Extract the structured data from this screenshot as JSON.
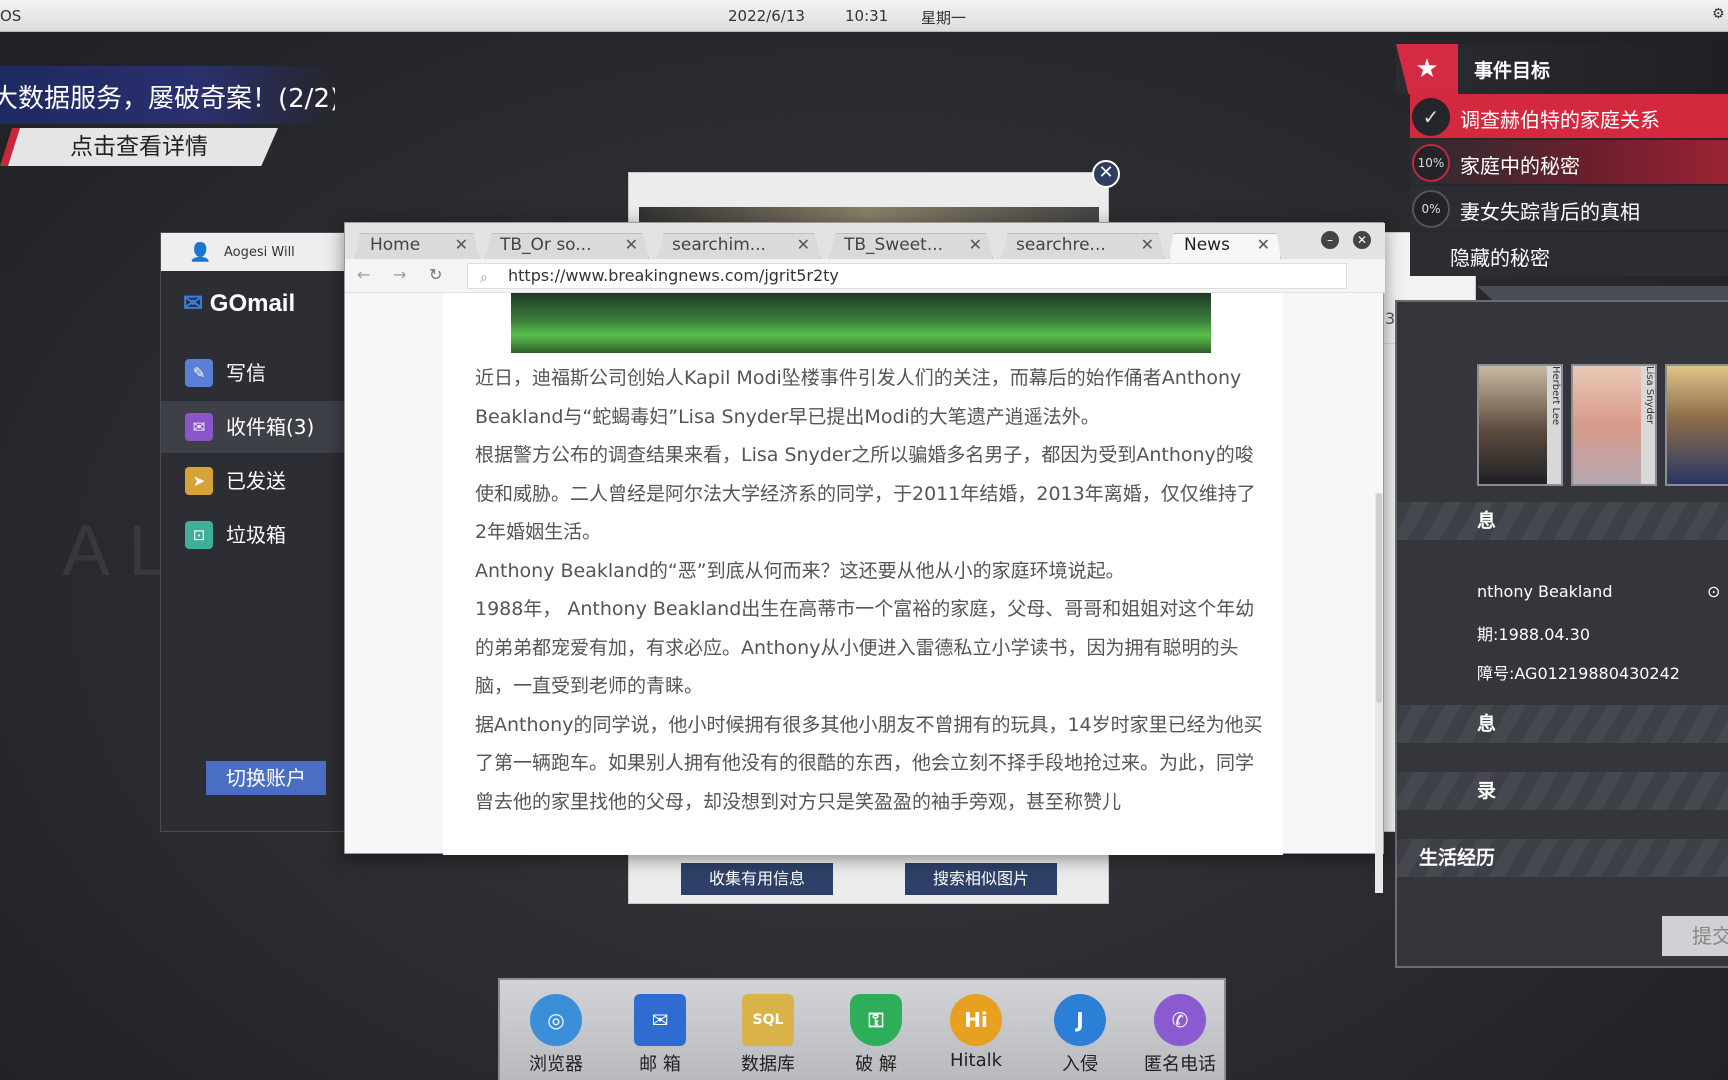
{
  "topbar": {
    "os": "OS",
    "date": "2022/6/13",
    "time": "10:31",
    "weekday": "星期一"
  },
  "banner": {
    "title": "大数据服务，屡破奇案！(2/2)",
    "details": "点击查看详情"
  },
  "background_text": "AL",
  "mail": {
    "user": "Aogesi Will",
    "logo": "GOmail",
    "items": [
      {
        "label": "写信",
        "icon": "compose-icon",
        "color": "#5a7fd6"
      },
      {
        "label": "收件箱(3)",
        "icon": "inbox-icon",
        "color": "#8a55c8"
      },
      {
        "label": "已发送",
        "icon": "send-icon",
        "color": "#d8a23a"
      },
      {
        "label": "垃圾箱",
        "icon": "trash-icon",
        "color": "#3fae9a"
      }
    ],
    "switch_account": "切换账户"
  },
  "image_window": {
    "collect": "收集有用信息",
    "search_similar": "搜索相似图片"
  },
  "browser": {
    "tabs": [
      {
        "label": "Home"
      },
      {
        "label": "TB_Or so..."
      },
      {
        "label": "searchim..."
      },
      {
        "label": "TB_Sweet..."
      },
      {
        "label": "searchre..."
      },
      {
        "label": "News",
        "active": true
      }
    ],
    "url": "https://www.breakingnews.com/jgrit5r2ty",
    "paragraphs": [
      "近日，迪福斯公司创始人Kapil Modi坠楼事件引发人们的关注，而幕后的始作俑者Anthony Beakland与“蛇蝎毒妇”Lisa Snyder早已提出Modi的大笔遗产逍遥法外。",
      "根据警方公布的调查结果来看，Lisa Snyder之所以骗婚多名男子，都因为受到Anthony的唆使和威胁。二人曾经是阿尔法大学经济系的同学，于2011年结婚，2013年离婚，仅仅维持了2年婚姻生活。",
      "Anthony Beakland的“恶”到底从何而来？这还要从他从小的家庭环境说起。",
      "1988年， Anthony Beakland出生在高蒂市一个富裕的家庭，父母、哥哥和姐姐对这个年幼的弟弟都宠爱有加，有求必应。Anthony从小便进入雷德私立小学读书，因为拥有聪明的头脑，一直受到老师的青睐。",
      "据Anthony的同学说，他小时候拥有很多其他小朋友不曾拥有的玩具，14岁时家里已经为他买了第一辆跑车。如果别人拥有他没有的很酷的东西，他会立刻不择手段地抢过来。为此，同学曾去他的家里找他的父母，却没想到对方只是笑盈盈的袖手旁观，甚至称赞儿"
    ]
  },
  "profile_window": {
    "partial_number": "3"
  },
  "objectives": {
    "title": "事件目标",
    "items": [
      {
        "badge": "✓",
        "text": "调查赫伯特的家庭关系",
        "done": true
      },
      {
        "badge": "10%",
        "text": "家庭中的秘密"
      },
      {
        "badge": "0%",
        "text": "妻女失踪背后的真相"
      },
      {
        "badge": "",
        "text": "隐藏的秘密"
      }
    ]
  },
  "characters": {
    "portraits": [
      {
        "name": "Herbert Lee"
      },
      {
        "name": "Lisa Snyder"
      },
      {
        "name": ""
      }
    ],
    "section1": "息",
    "name_line": "nthony Beakland",
    "birth_line": "期:1988.04.30",
    "id_line": "障号:AG01219880430242",
    "section2": "息",
    "section3": "录",
    "section4": "生活经历",
    "submit": "提交"
  },
  "dock": [
    {
      "label": "浏览器",
      "icon": "globe-icon",
      "glyph": "◎",
      "color": "#3a8fd8"
    },
    {
      "label": "邮 箱",
      "icon": "mail-icon",
      "glyph": "✉",
      "color": "#2f6bd0"
    },
    {
      "label": "数据库",
      "icon": "sql-icon",
      "glyph": "SQL",
      "color": "#d9b24a"
    },
    {
      "label": "破 解",
      "icon": "shield-icon",
      "glyph": "⚿",
      "color": "#2fae5a"
    },
    {
      "label": "Hitalk",
      "icon": "hitalk-icon",
      "glyph": "Hi",
      "color": "#e8a020"
    },
    {
      "label": "入侵",
      "icon": "hook-icon",
      "glyph": "J",
      "color": "#2c7fd6"
    },
    {
      "label": "匿名电话",
      "icon": "phone-icon",
      "glyph": "✆",
      "color": "#8a5ad0"
    }
  ]
}
